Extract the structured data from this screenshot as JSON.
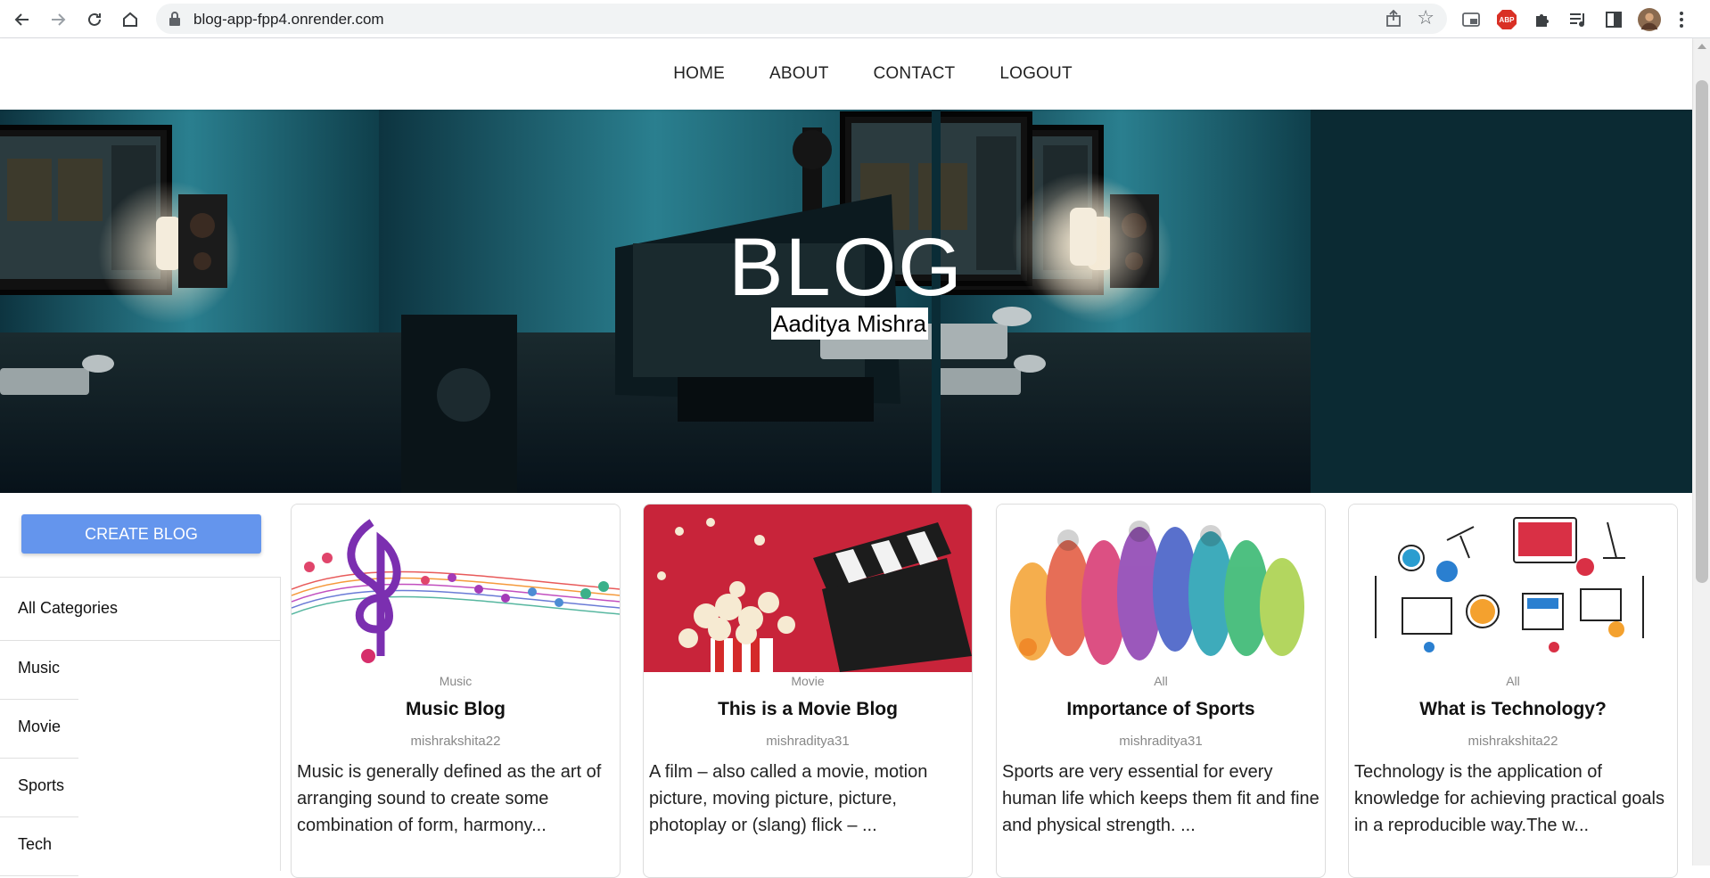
{
  "browser": {
    "url": "blog-app-fpp4.onrender.com",
    "extensions": [
      "cast-icon",
      "adblock-icon",
      "puzzle-icon",
      "media-icon",
      "sidepanel-icon",
      "profile-avatar",
      "kebab-menu-icon"
    ],
    "abp_label": "ABP"
  },
  "nav": {
    "items": [
      {
        "label": "HOME"
      },
      {
        "label": "ABOUT"
      },
      {
        "label": "CONTACT"
      },
      {
        "label": "LOGOUT"
      }
    ]
  },
  "hero": {
    "title": "BLOG",
    "subtitle": "Aaditya Mishra"
  },
  "sidebar": {
    "create_label": "CREATE BLOG",
    "all_label": "All Categories",
    "categories": [
      {
        "label": "Music"
      },
      {
        "label": "Movie"
      },
      {
        "label": "Sports"
      },
      {
        "label": "Tech"
      }
    ]
  },
  "posts": [
    {
      "category": "Music",
      "title": "Music Blog",
      "author": "mishrakshita22",
      "excerpt": "Music is generally defined as the art of arranging sound to create some combination of form, harmony..."
    },
    {
      "category": "Movie",
      "title": "This is a Movie Blog",
      "author": "mishraditya31",
      "excerpt": "A film – also called a movie, motion picture, moving picture, picture, photoplay or (slang) flick – ..."
    },
    {
      "category": "All",
      "title": "Importance of Sports",
      "author": "mishraditya31",
      "excerpt": "Sports are very essential for every human life which keeps them fit and fine and physical strength. ..."
    },
    {
      "category": "All",
      "title": "What is Technology?",
      "author": "mishrakshita22",
      "excerpt": "Technology is the application of knowledge for achieving practical goals in a reproducible way.The w..."
    }
  ],
  "colors": {
    "button": "#6495ed",
    "hero_bg": "#0b2a33",
    "movie_bg": "#c8243a"
  }
}
